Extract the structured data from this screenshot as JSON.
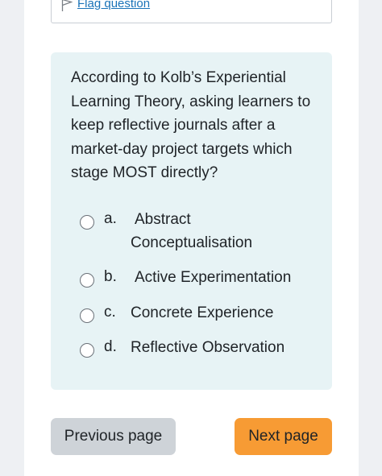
{
  "flag": {
    "label": "Flag question",
    "icon": "flag-outline-icon"
  },
  "question": {
    "text": "According to Kolb’s Experiential Learning Theory, asking learners to keep reflective journals after a market-day project targets which stage MOST directly?",
    "options": [
      {
        "letter": "a.",
        "text_line1": "Abstract",
        "text_line2": "Conceptualisation",
        "selected": false
      },
      {
        "letter": "b.",
        "text": "Active Experimentation",
        "selected": false
      },
      {
        "letter": "c.",
        "text": "Concrete Experience",
        "selected": false
      },
      {
        "letter": "d.",
        "text": "Reflective Observation",
        "selected": false
      }
    ]
  },
  "navigation": {
    "previous_label": "Previous page",
    "next_label": "Next page"
  },
  "colors": {
    "card_background": "#e7f3f5",
    "next_button": "#f79b34",
    "previous_button": "#ced3d8",
    "link": "#1a73b8"
  }
}
